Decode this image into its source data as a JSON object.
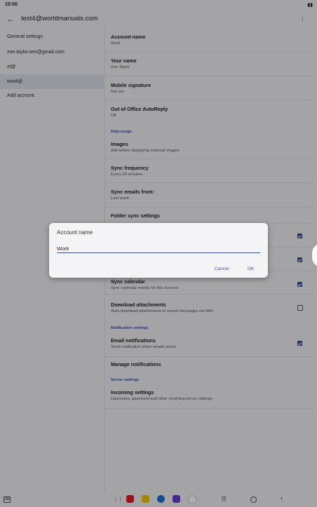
{
  "status": {
    "time": "10:00"
  },
  "appbar": {
    "title": "test4@worldmanuals.com"
  },
  "left": {
    "items": [
      {
        "label": "General settings"
      },
      {
        "label": "zoe.taylor.wm@gmail.com"
      },
      {
        "label": "zt@"
      },
      {
        "label": "test4@"
      },
      {
        "label": "Add account"
      }
    ]
  },
  "right": {
    "account_name": {
      "title": "Account name",
      "sub": "Work"
    },
    "your_name": {
      "title": "Your name",
      "sub": "Zoe Taylor"
    },
    "signature": {
      "title": "Mobile signature",
      "sub": "Not set"
    },
    "ooo": {
      "title": "Out of Office AutoReply",
      "sub": "Off"
    },
    "section_data": "Data usage",
    "images": {
      "title": "Images",
      "sub": "Ask before displaying external images"
    },
    "sync_freq": {
      "title": "Sync frequency",
      "sub": "Every 30 minutes"
    },
    "sync_from": {
      "title": "Sync emails from:",
      "sub": "Last week"
    },
    "folder_sync": {
      "title": "Folder sync settings"
    },
    "sync_calendar": {
      "title": "Sync calendar",
      "sub": "Sync calendar events for this account",
      "checked": true
    },
    "download": {
      "title": "Download attachments",
      "sub": "Auto-download attachments to recent messages via WiFi",
      "checked": false
    },
    "section_notif": "Notification settings",
    "email_notif": {
      "title": "Email notifications",
      "sub": "Send notification when emails arrive",
      "checked": true
    },
    "manage_notif": {
      "title": "Manage notifications"
    },
    "section_server": "Server settings",
    "incoming": {
      "title": "Incoming settings",
      "sub": "Username, password and other incoming server settings"
    }
  },
  "dialog": {
    "title": "Account name",
    "value": "Work",
    "cancel": "Cancel",
    "ok": "OK"
  },
  "colors": {
    "accent": "#3b4fa1",
    "checkbox": "#3b4a8c"
  }
}
